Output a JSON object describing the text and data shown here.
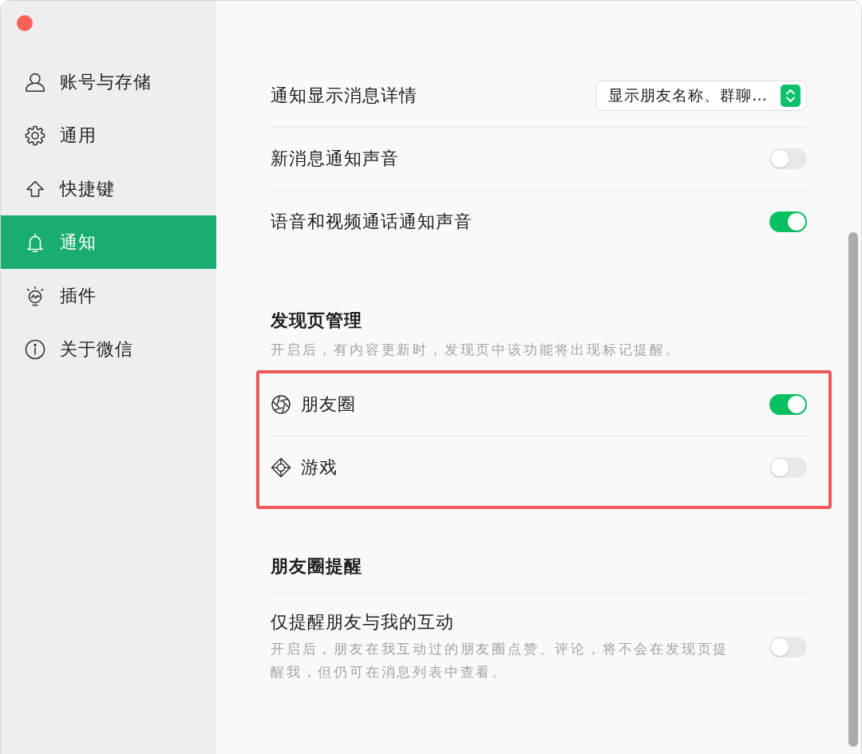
{
  "sidebar": {
    "items": [
      {
        "label": "账号与存储",
        "selected": false
      },
      {
        "label": "通用",
        "selected": false
      },
      {
        "label": "快捷键",
        "selected": false
      },
      {
        "label": "通知",
        "selected": true
      },
      {
        "label": "插件",
        "selected": false
      },
      {
        "label": "关于微信",
        "selected": false
      }
    ]
  },
  "sections": [
    {
      "rows": [
        {
          "kind": "select",
          "label": "通知显示消息详情",
          "value": "显示朋友名称、群聊…"
        },
        {
          "kind": "toggle",
          "label": "新消息通知声音",
          "on": false
        },
        {
          "kind": "toggle",
          "label": "语音和视频通话通知声音",
          "on": true
        }
      ]
    },
    {
      "title": "发现页管理",
      "description": "开启后，有内容更新时，发现页中该功能将出现标记提醒。",
      "highlighted": true,
      "rows": [
        {
          "kind": "feature",
          "label": "朋友圈",
          "on": true
        },
        {
          "kind": "feature",
          "label": "游戏",
          "on": false
        }
      ]
    },
    {
      "title": "朋友圈提醒",
      "rows": [
        {
          "kind": "toggle",
          "label": "仅提醒朋友与我的互动",
          "description": "开启后，朋友在我互动过的朋友圈点赞、评论，将不会在发现页提醒我，但仍可在消息列表中查看。",
          "on": false
        }
      ]
    }
  ]
}
